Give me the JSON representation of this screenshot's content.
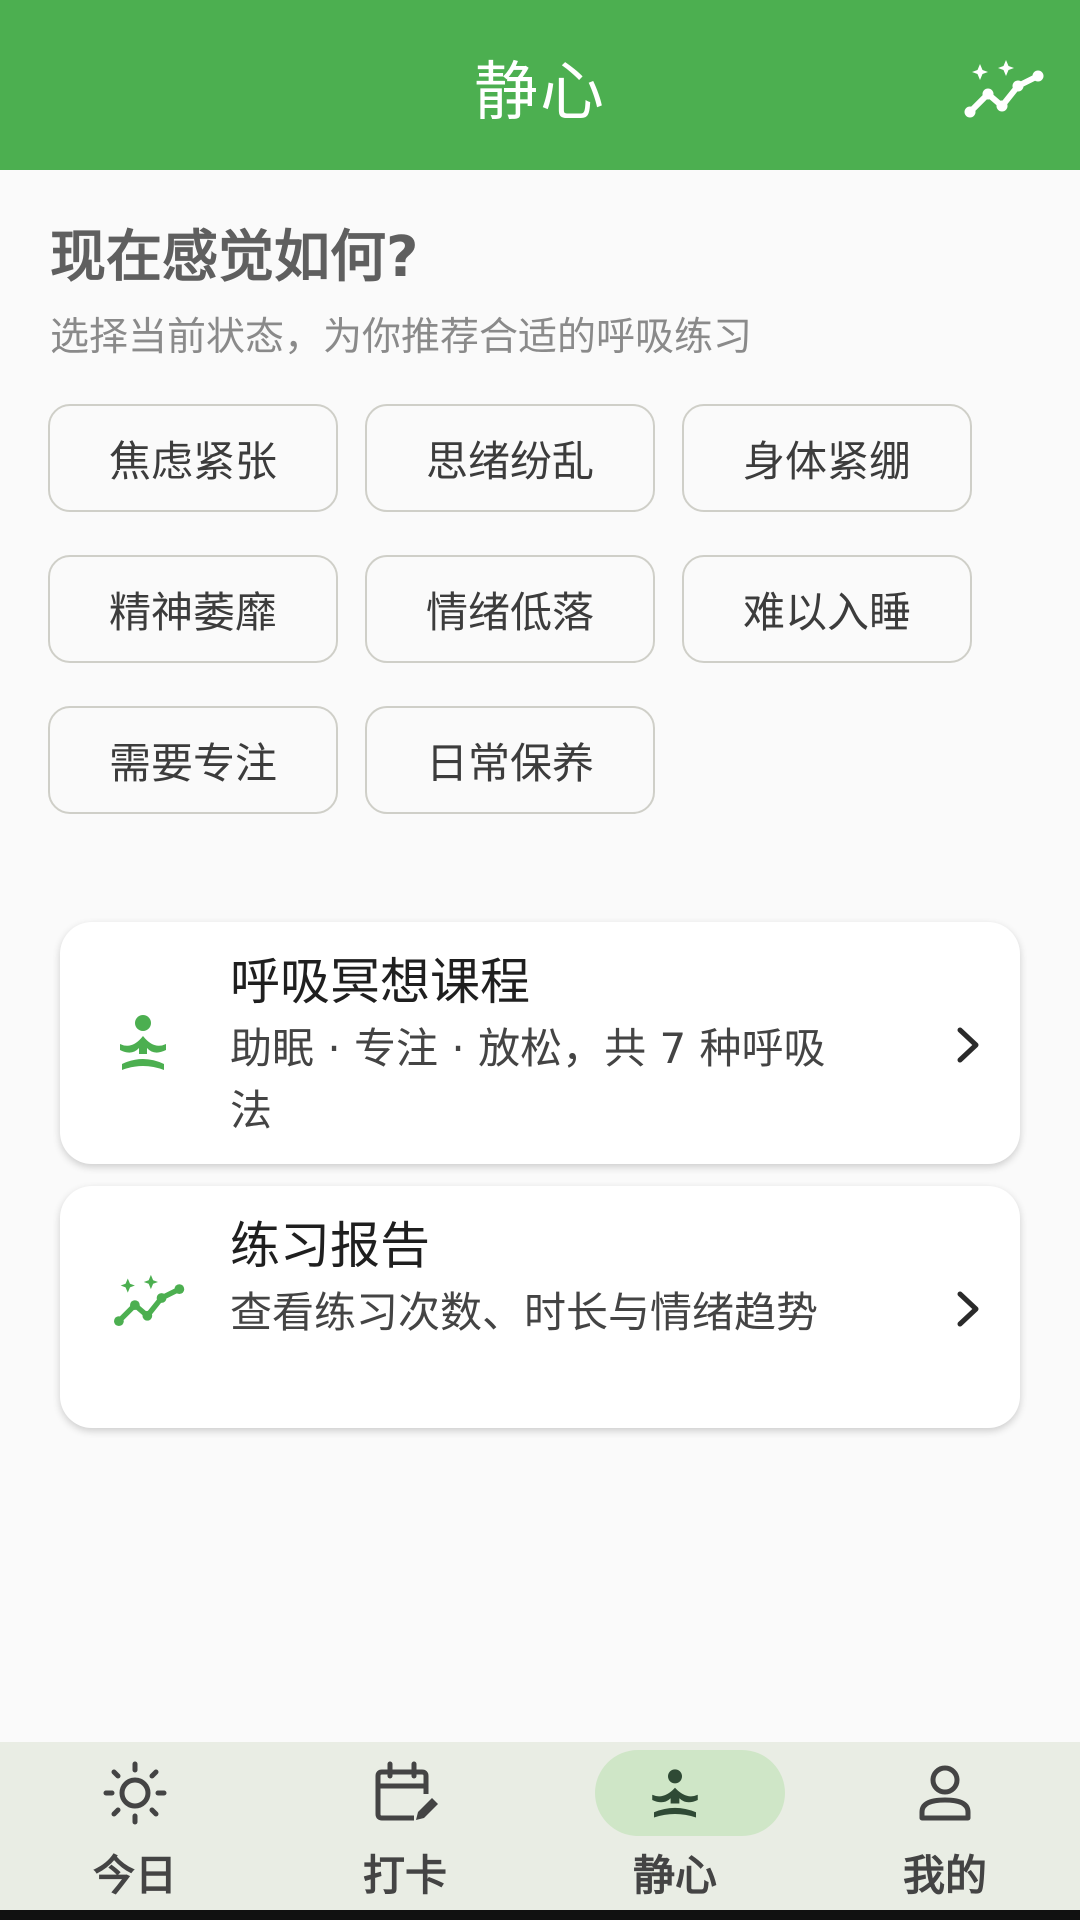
{
  "header": {
    "title": "静心",
    "action_icon": "trend-sparkle-icon",
    "background": "#4caf50"
  },
  "mood": {
    "question": "现在感觉如何?",
    "subtitle": "选择当前状态，为你推荐合适的呼吸练习",
    "chips": [
      "焦虑紧张",
      "思绪纷乱",
      "身体紧绷",
      "精神萎靡",
      "情绪低落",
      "难以入睡",
      "需要专注",
      "日常保养"
    ]
  },
  "cards": [
    {
      "title": "呼吸冥想课程",
      "description": "助眠 · 专注 · 放松，共 7 种呼吸法",
      "icon": "meditation-icon"
    },
    {
      "title": "练习报告",
      "description": "查看练习次数、时长与情绪趋势",
      "icon": "trend-sparkle-icon"
    }
  ],
  "bottom_nav": {
    "items": [
      {
        "label": "今日",
        "icon": "sun-icon",
        "active": false
      },
      {
        "label": "打卡",
        "icon": "calendar-edit-icon",
        "active": false
      },
      {
        "label": "静心",
        "icon": "meditation-icon",
        "active": true
      },
      {
        "label": "我的",
        "icon": "person-icon",
        "active": false
      }
    ]
  },
  "colors": {
    "accent": "#4caf50",
    "icon_green": "#4caf50",
    "active_pill": "#cfe6c7",
    "nav_background": "#e9ede4"
  }
}
